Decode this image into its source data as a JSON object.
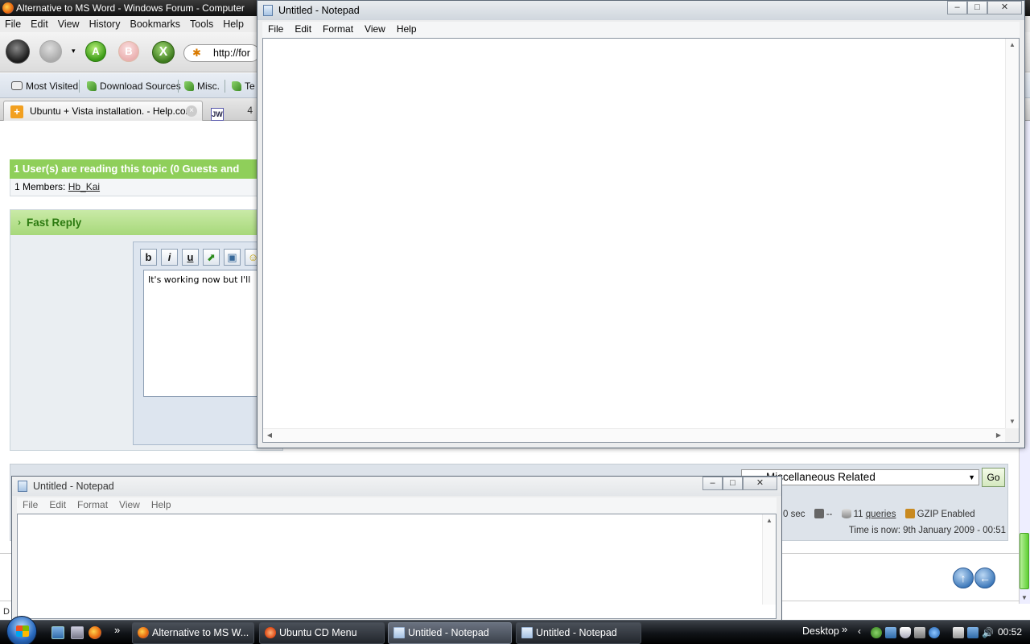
{
  "browser": {
    "title": "Alternative to MS Word - Windows Forum - Computer",
    "menu": [
      "File",
      "Edit",
      "View",
      "History",
      "Bookmarks",
      "Tools",
      "Help"
    ],
    "nav": {
      "a_label": "A",
      "b_label": "B",
      "x_label": "X",
      "url": "http://for"
    },
    "bookmarks": [
      "Most Visited",
      "Download Sources",
      "Misc.",
      "Te"
    ],
    "tabs": [
      {
        "label": "Ubuntu + Vista installation. - Help.com",
        "icon": "+"
      },
      {
        "label": "4",
        "icon": "JW"
      }
    ]
  },
  "forum": {
    "users_reading": "1 User(s) are reading this topic (0 Guests and",
    "members_prefix": "1 Members:",
    "member_name": "Hb_Kai",
    "fast_reply_title": "Fast Reply",
    "editor_buttons": [
      "b",
      "i",
      "u"
    ],
    "editor_text": "It's working now but I'll",
    "jump_select_value": "Miscellaneous Related",
    "go_label": "Go",
    "stats": {
      "sec": "0 sec",
      "dash": "--",
      "queries_count": "11",
      "queries_label": "queries",
      "gzip": "GZIP Enabled"
    },
    "time_now": "Time is now: 9th January 2009 - 00:51",
    "footer_char": "D"
  },
  "notepad_front": {
    "title": "Untitled - Notepad",
    "menu": [
      "File",
      "Edit",
      "Format",
      "View",
      "Help"
    ],
    "content": ""
  },
  "notepad_back": {
    "title": "Untitled - Notepad",
    "menu": [
      "File",
      "Edit",
      "Format",
      "View",
      "Help"
    ],
    "content": ""
  },
  "taskbar": {
    "items": [
      {
        "label": "Alternative to MS W...",
        "icon": "firefox-icon"
      },
      {
        "label": "Ubuntu CD Menu",
        "icon": "ubuntu-icon"
      },
      {
        "label": "Untitled - Notepad",
        "icon": "notepad-icon"
      },
      {
        "label": "Untitled - Notepad",
        "icon": "notepad-icon"
      }
    ],
    "toolbar_label": "Desktop",
    "clock": "00:52"
  }
}
